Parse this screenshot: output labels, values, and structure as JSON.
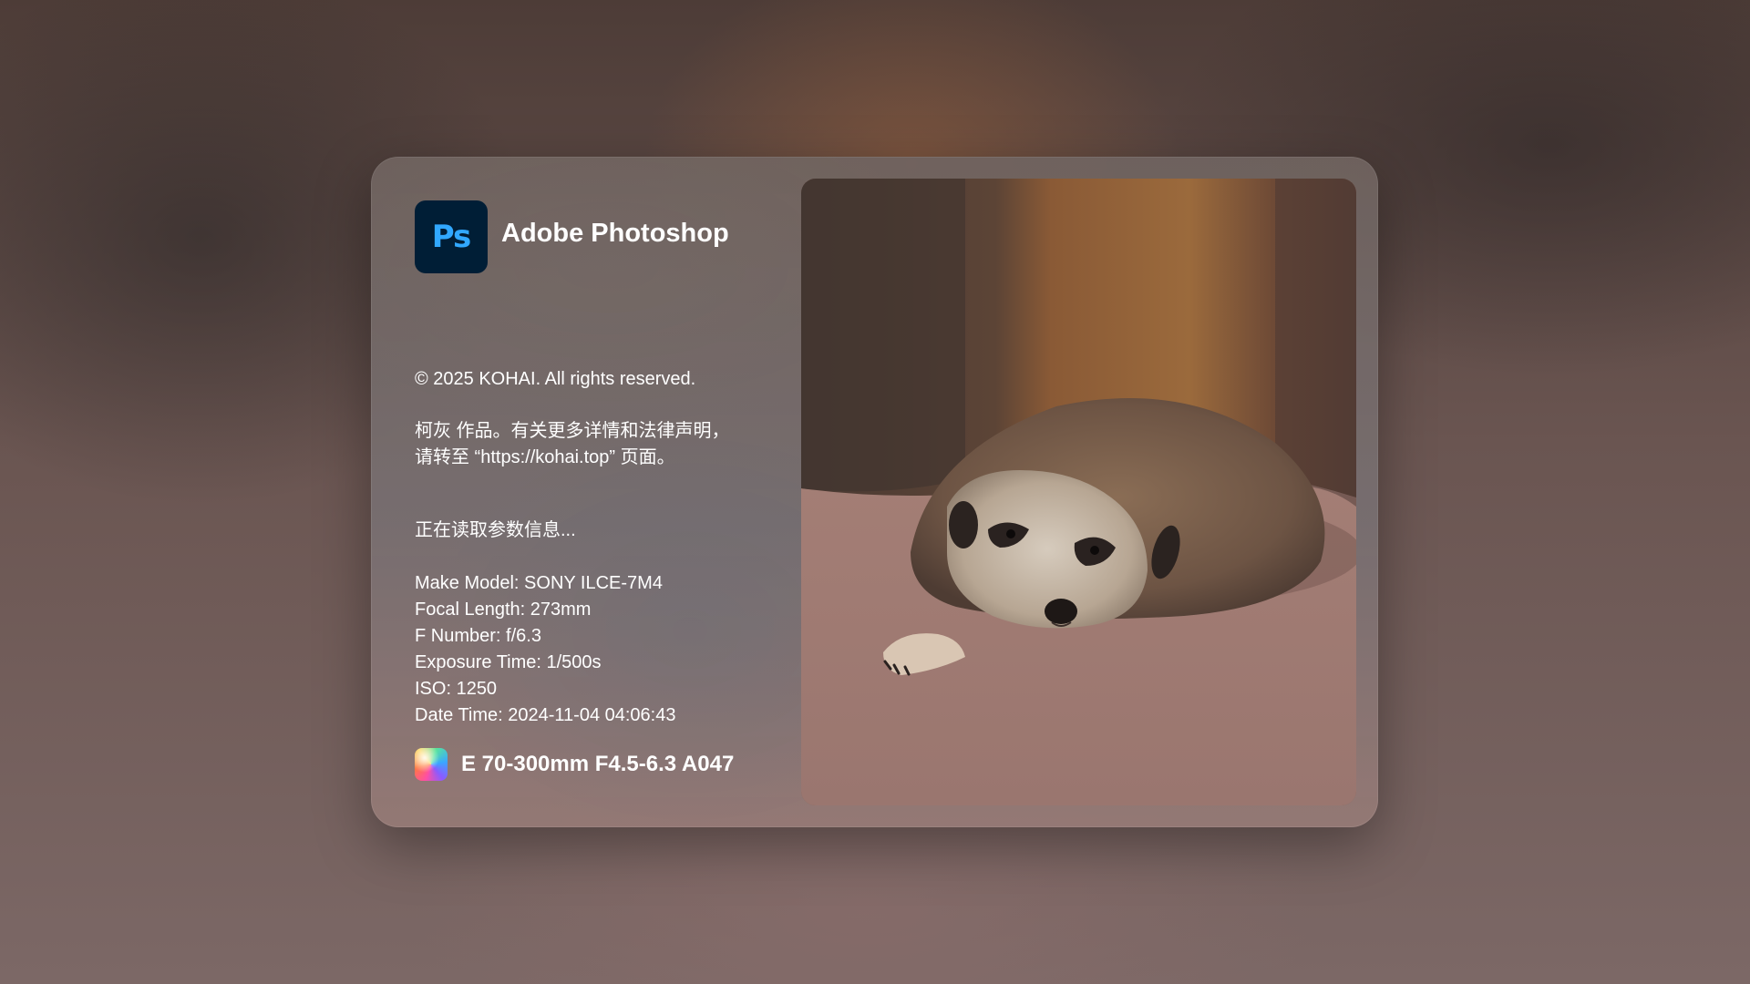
{
  "app": {
    "logo_text": "Ps",
    "title": "Adobe Photoshop",
    "logo_bg": "#001e36",
    "logo_fg": "#31a8ff"
  },
  "about": {
    "copyright": "© 2025 KOHAI. All rights reserved.",
    "notice_line1": "柯灰 作品。有关更多详情和法律声明，",
    "notice_line2": "请转至 “https://kohai.top” 页面。",
    "loading": "正在读取参数信息..."
  },
  "exif": {
    "make_model": "Make Model: SONY ILCE-7M4",
    "focal_length": "Focal Length: 273mm",
    "f_number": "F Number: f/6.3",
    "exposure_time": "Exposure Time: 1/500s",
    "iso": "ISO: 1250",
    "date_time": "Date Time: 2024-11-04 04:06:43"
  },
  "lens": {
    "icon": "lens-gradient-icon",
    "name": "E 70-300mm F4.5-6.3 A047"
  }
}
